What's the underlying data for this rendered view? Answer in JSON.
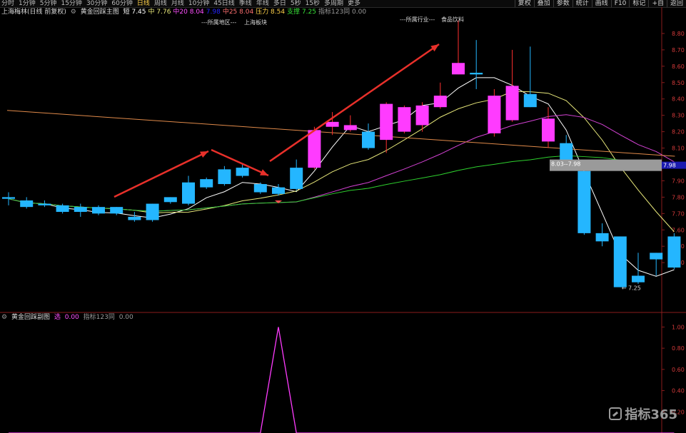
{
  "toolbar": {
    "tabs": [
      "分时",
      "1分钟",
      "5分钟",
      "15分钟",
      "30分钟",
      "60分钟",
      "日线",
      "周线",
      "月线",
      "10分钟",
      "45日线",
      "季线",
      "年线",
      "多日",
      "5秒",
      "15秒",
      "多周期",
      "更多"
    ],
    "active_tab": "日线",
    "right_buttons": [
      "复权",
      "叠加",
      "参数",
      "统计",
      "画线",
      "F10",
      "标记",
      "+自",
      "返回"
    ]
  },
  "info": {
    "stock": "上海梅林(日线 前复权)",
    "indicator": "黄金回踩主图",
    "items": [
      {
        "label": "短",
        "value": "7.45",
        "color": "#ffffff"
      },
      {
        "label": "中",
        "value": "7.76",
        "color": "#e8e87a"
      },
      {
        "label": "中20",
        "value": "8.04",
        "color": "#ff4fff"
      },
      {
        "label": "",
        "value": "7.98",
        "color": "#2424ff"
      },
      {
        "label": "中25",
        "value": "8.04",
        "color": "#ff7070"
      },
      {
        "label": "压力",
        "value": "8.54",
        "color": "#ffd24a"
      },
      {
        "label": "支撑",
        "value": "7.25",
        "color": "#38e038"
      },
      {
        "label": "指标123同",
        "value": "0.00",
        "color": "#9a9a9a"
      }
    ]
  },
  "annotations": {
    "region": "---所属地区---",
    "region_val": "上海板块",
    "industry": "---所属行业---",
    "industry_val": "食品饮料",
    "price_box_text": "8.03--7.98",
    "price_box_price": "7.98",
    "low_label": "7.25"
  },
  "sub": {
    "title": "黄金回踩副图",
    "item1_label": "选",
    "item1_value": "0.00",
    "item2_label": "指标123同",
    "item2_value": "0.00"
  },
  "colors": {
    "up": "#ff3bff",
    "down": "#24b6ff",
    "arrow": "#e8302a"
  },
  "watermark": "指标365",
  "chart_data": [
    {
      "type": "candlestick",
      "title": "黄金回踩主图",
      "ylim": [
        7.1,
        8.9
      ],
      "yticks": [
        8.8,
        8.7,
        8.6,
        8.5,
        8.4,
        8.3,
        8.2,
        8.1,
        8.0,
        7.9,
        7.8,
        7.7,
        7.6,
        7.5,
        7.4
      ],
      "candles": [
        {
          "o": 7.8,
          "c": 7.79,
          "h": 7.83,
          "l": 7.75
        },
        {
          "o": 7.78,
          "c": 7.74,
          "h": 7.8,
          "l": 7.73
        },
        {
          "o": 7.76,
          "c": 7.75,
          "h": 7.78,
          "l": 7.74
        },
        {
          "o": 7.75,
          "c": 7.71,
          "h": 7.76,
          "l": 7.7
        },
        {
          "o": 7.74,
          "c": 7.71,
          "h": 7.76,
          "l": 7.68
        },
        {
          "o": 7.74,
          "c": 7.7,
          "h": 7.75,
          "l": 7.69
        },
        {
          "o": 7.74,
          "c": 7.7,
          "h": 7.74,
          "l": 7.69
        },
        {
          "o": 7.68,
          "c": 7.66,
          "h": 7.71,
          "l": 7.65
        },
        {
          "o": 7.76,
          "c": 7.66,
          "h": 7.76,
          "l": 7.65
        },
        {
          "o": 7.8,
          "c": 7.77,
          "h": 7.8,
          "l": 7.76
        },
        {
          "o": 7.89,
          "c": 7.76,
          "h": 7.93,
          "l": 7.75
        },
        {
          "o": 7.91,
          "c": 7.86,
          "h": 7.92,
          "l": 7.85
        },
        {
          "o": 7.97,
          "c": 7.88,
          "h": 7.99,
          "l": 7.87
        },
        {
          "o": 7.98,
          "c": 7.93,
          "h": 8.0,
          "l": 7.92
        },
        {
          "o": 7.88,
          "c": 7.83,
          "h": 7.89,
          "l": 7.82
        },
        {
          "o": 7.86,
          "c": 7.82,
          "h": 7.88,
          "l": 7.81
        },
        {
          "o": 7.98,
          "c": 7.85,
          "h": 8.03,
          "l": 7.84
        },
        {
          "o": 7.98,
          "c": 8.21,
          "h": 8.23,
          "l": 7.97
        },
        {
          "o": 8.23,
          "c": 8.26,
          "h": 8.32,
          "l": 8.18
        },
        {
          "o": 8.21,
          "c": 8.24,
          "h": 8.3,
          "l": 8.2
        },
        {
          "o": 8.2,
          "c": 8.1,
          "h": 8.25,
          "l": 8.09
        },
        {
          "o": 8.15,
          "c": 8.37,
          "h": 8.38,
          "l": 8.07
        },
        {
          "o": 8.2,
          "c": 8.35,
          "h": 8.36,
          "l": 8.19
        },
        {
          "o": 8.24,
          "c": 8.36,
          "h": 8.38,
          "l": 8.2
        },
        {
          "o": 8.35,
          "c": 8.42,
          "h": 8.5,
          "l": 8.34
        },
        {
          "o": 8.55,
          "c": 8.62,
          "h": 8.88,
          "l": 8.55
        },
        {
          "o": 8.56,
          "c": 8.55,
          "h": 8.76,
          "l": 8.46
        },
        {
          "o": 8.19,
          "c": 8.42,
          "h": 8.46,
          "l": 8.17
        },
        {
          "o": 8.27,
          "c": 8.48,
          "h": 8.7,
          "l": 8.26
        },
        {
          "o": 8.43,
          "c": 8.35,
          "h": 8.72,
          "l": 8.35
        },
        {
          "o": 8.14,
          "c": 8.28,
          "h": 8.35,
          "l": 8.1
        },
        {
          "o": 8.13,
          "c": 8.0,
          "h": 8.18,
          "l": 7.99
        },
        {
          "o": 7.96,
          "c": 7.58,
          "h": 7.97,
          "l": 7.57
        },
        {
          "o": 7.58,
          "c": 7.53,
          "h": 7.64,
          "l": 7.5
        },
        {
          "o": 7.56,
          "c": 7.25,
          "h": 7.56,
          "l": 7.25
        },
        {
          "o": 7.32,
          "c": 7.28,
          "h": 7.46,
          "l": 7.27
        },
        {
          "o": 7.46,
          "c": 7.42,
          "h": 7.46,
          "l": 7.32
        },
        {
          "o": 7.56,
          "c": 7.37,
          "h": 7.58,
          "l": 7.36
        }
      ]
    },
    {
      "type": "line",
      "title": "黄金回踩副图",
      "ylim": [
        0.0,
        1.05
      ],
      "yticks": [
        1.0,
        0.8,
        0.6,
        0.4,
        0.2
      ],
      "yticklabels": [
        "1.00",
        "0.80",
        "0.60",
        "0.40",
        "0.20"
      ],
      "series": [
        {
          "values": [
            0,
            0,
            0,
            0,
            0,
            0,
            0,
            0,
            0,
            0,
            0,
            0,
            0,
            0,
            0,
            1,
            0,
            0,
            0,
            0,
            0,
            0,
            0,
            0,
            0,
            0,
            0,
            0,
            0,
            0,
            0,
            0,
            0,
            0,
            0,
            0,
            0,
            0
          ]
        }
      ]
    }
  ]
}
